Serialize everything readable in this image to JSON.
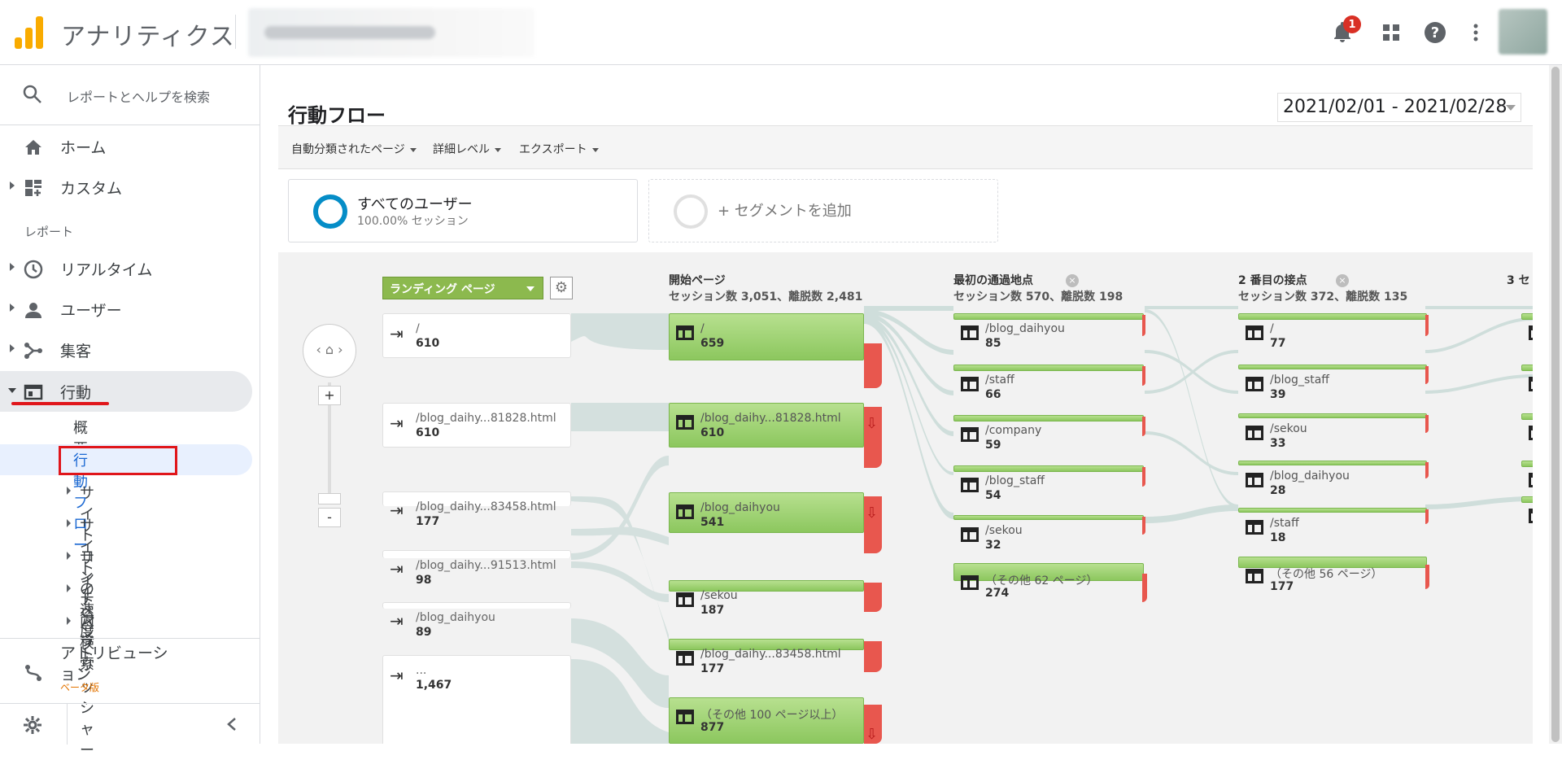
{
  "app": {
    "title": "アナリティクス",
    "notification_count": "1"
  },
  "sidebar": {
    "search_placeholder": "レポートとヘルプを検索",
    "home": "ホーム",
    "custom": "カスタム",
    "reports_label": "レポート",
    "realtime": "リアルタイム",
    "users": "ユーザー",
    "acquisition": "集客",
    "behavior": "行動",
    "behavior_sub": {
      "overview": "概要",
      "flow": "行動フロー",
      "site_content": "サイト コンテンツ",
      "site_speed": "サイトの速度",
      "site_search": "サイト内検索",
      "events": "イベント",
      "publisher": "パブリッシャー"
    },
    "attribution": "アトリビューション",
    "beta": "ベータ版"
  },
  "page": {
    "title": "行動フロー",
    "date_range": "2021/02/01 - 2021/02/28",
    "toolbar": [
      "自動分類されたページ",
      "詳細レベル",
      "エクスポート"
    ],
    "segments": [
      {
        "name": "すべてのユーザー",
        "sub": "100.00% セッション"
      },
      {
        "name": "+ セグメントを追加"
      }
    ]
  },
  "flow": {
    "landing_dropdown": "ランディング ページ",
    "landing_nodes": [
      {
        "label": "/",
        "value": "610"
      },
      {
        "label": "/blog_daihy...81828.html",
        "value": "610"
      },
      {
        "label": "/blog_daihy...83458.html",
        "value": "177"
      },
      {
        "label": "/blog_daihy...91513.html",
        "value": "98"
      },
      {
        "label": "/blog_daihyou",
        "value": "89"
      },
      {
        "label": "...",
        "value": "1,467"
      }
    ],
    "columns": [
      {
        "title": "開始ページ",
        "stats": "セッション数 3,051、離脱数 2,481",
        "nodes": [
          {
            "label": "/",
            "value": "659"
          },
          {
            "label": "/blog_daihy...81828.html",
            "value": "610"
          },
          {
            "label": "/blog_daihyou",
            "value": "541"
          },
          {
            "label": "/sekou",
            "value": "187"
          },
          {
            "label": "/blog_daihy...83458.html",
            "value": "177"
          },
          {
            "label": "（その他 100 ページ以上）",
            "value": "877"
          }
        ]
      },
      {
        "title": "最初の通過地点",
        "stats": "セッション数 570、離脱数 198",
        "nodes": [
          {
            "label": "/blog_daihyou",
            "value": "85"
          },
          {
            "label": "/staff",
            "value": "66"
          },
          {
            "label": "/company",
            "value": "59"
          },
          {
            "label": "/blog_staff",
            "value": "54"
          },
          {
            "label": "/sekou",
            "value": "32"
          },
          {
            "label": "（その他 62 ページ）",
            "value": "274"
          }
        ]
      },
      {
        "title": "2 番目の接点",
        "stats": "セッション数 372、離脱数 135",
        "nodes": [
          {
            "label": "/",
            "value": "77"
          },
          {
            "label": "/blog_staff",
            "value": "39"
          },
          {
            "label": "/sekou",
            "value": "33"
          },
          {
            "label": "/blog_daihyou",
            "value": "28"
          },
          {
            "label": "/staff",
            "value": "18"
          },
          {
            "label": "（その他 56 ページ）",
            "value": "177"
          }
        ]
      }
    ],
    "next_col_partial": "3 セ",
    "zoom_in": "+",
    "zoom_out": "-"
  }
}
